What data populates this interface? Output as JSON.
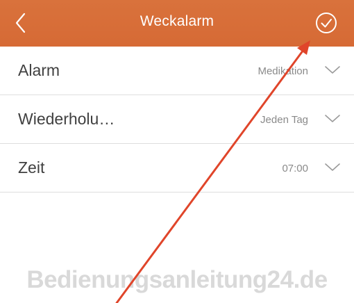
{
  "header": {
    "back_icon": "chevron-left-icon",
    "title": "Weckalarm",
    "confirm_icon": "check-circle-icon",
    "background_color": "#d66a35"
  },
  "rows": [
    {
      "label": "Alarm",
      "value": "Medikation",
      "icon": "chevron-down-icon"
    },
    {
      "label": "Wiederholu…",
      "value": "Jeden Tag",
      "icon": "chevron-down-icon"
    },
    {
      "label": "Zeit",
      "value": "07:00",
      "icon": "chevron-down-icon"
    }
  ],
  "watermark": "Bedienungsanleitung24.de",
  "annotation": {
    "arrow_color": "#e0452a",
    "arrow_icon": "red-annotation-arrow-icon"
  }
}
